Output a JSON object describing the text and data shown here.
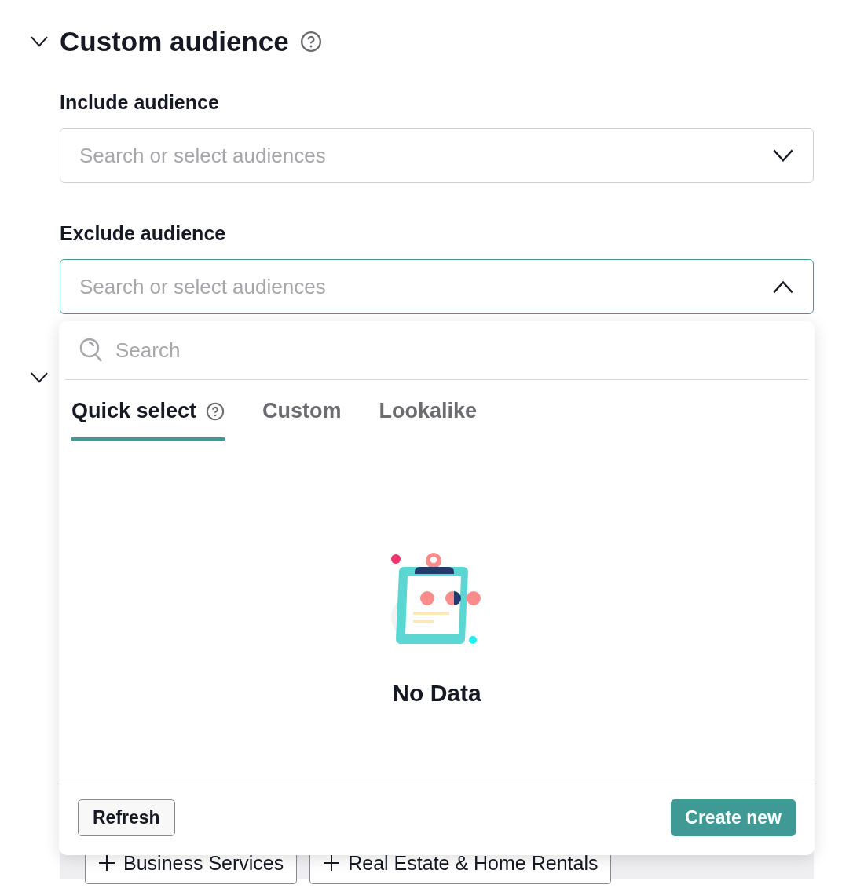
{
  "section": {
    "title": "Custom audience",
    "expanded": true
  },
  "fields": [
    {
      "label": "Include audience",
      "placeholder": "Search or select audiences",
      "open": false
    },
    {
      "label": "Exclude audience",
      "placeholder": "Search or select audiences",
      "open": true
    }
  ],
  "dropdown": {
    "search_placeholder": "Search",
    "tabs": [
      {
        "label": "Quick select",
        "selected": true,
        "help": true
      },
      {
        "label": "Custom",
        "selected": false,
        "help": false
      },
      {
        "label": "Lookalike",
        "selected": false,
        "help": false
      }
    ],
    "empty_text": "No Data",
    "buttons": [
      {
        "label": "Refresh",
        "kind": "secondary"
      },
      {
        "label": "Create new",
        "kind": "primary"
      }
    ]
  },
  "next_section": {
    "expanded": true,
    "chips": [
      "Business Services",
      "Real Estate & Home Rentals"
    ]
  }
}
